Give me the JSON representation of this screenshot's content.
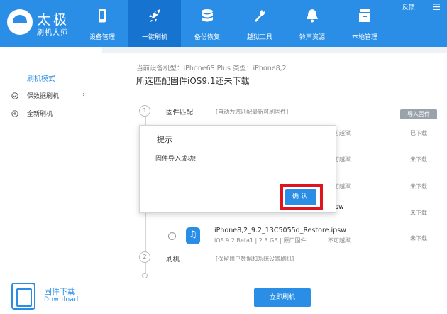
{
  "header": {
    "logo_big": "太极",
    "logo_small": "刷机大师",
    "nav": [
      {
        "label": "设备管理",
        "icon": "phone-icon"
      },
      {
        "label": "一键刷机",
        "icon": "rocket-icon",
        "active": true
      },
      {
        "label": "备份恢复",
        "icon": "database-icon"
      },
      {
        "label": "越狱工具",
        "icon": "wrench-icon"
      },
      {
        "label": "铃声资源",
        "icon": "bell-icon"
      },
      {
        "label": "本地管理",
        "icon": "box-icon"
      }
    ],
    "feedback": "反馈",
    "menu_icon": "menu-icon",
    "accent_color": "#2a8ee6",
    "active_color": "#1673d0"
  },
  "sidebar": {
    "title": "刷机模式",
    "items": [
      {
        "label": "保数据刷机",
        "icon": "check-circle-icon"
      },
      {
        "label": "全新刷机",
        "icon": "plus-circle-icon"
      }
    ],
    "download_title": "固件下载",
    "download_sub": "Download"
  },
  "main": {
    "device_info": "当前设备机型：iPhone6S Plus  类型：iPhone8,2",
    "headline": "所选匹配固件iOS9.1还未下载",
    "step1": {
      "num": "1",
      "label": "固件匹配",
      "hint": "[自动为您匹配最新可刷固件]"
    },
    "import_btn": "导入固件",
    "rows": [
      {
        "note": "不可越狱",
        "status": "已下载"
      },
      {
        "note": "不可越狱",
        "status": "未下载"
      },
      {
        "note": "不可越狱",
        "status": "未下载"
      },
      {
        "note": "",
        "name_tail": ".psw",
        "status": "未下载"
      }
    ],
    "firmware": {
      "name": "iPhone8,2_9.2_13C5055d_Restore.ipsw",
      "meta": "iOS 9.2 Beta1 | 2.3 GB | 原厂固件",
      "note": "不可越狱",
      "status": "未下载"
    },
    "step2": {
      "num": "2",
      "label": "刷机",
      "hint": "[保留用户数据和系统设置刷机]"
    },
    "flash_btn": "立即刷机"
  },
  "dialog": {
    "title": "提示",
    "message": "固件导入成功!",
    "ok": "确认"
  }
}
